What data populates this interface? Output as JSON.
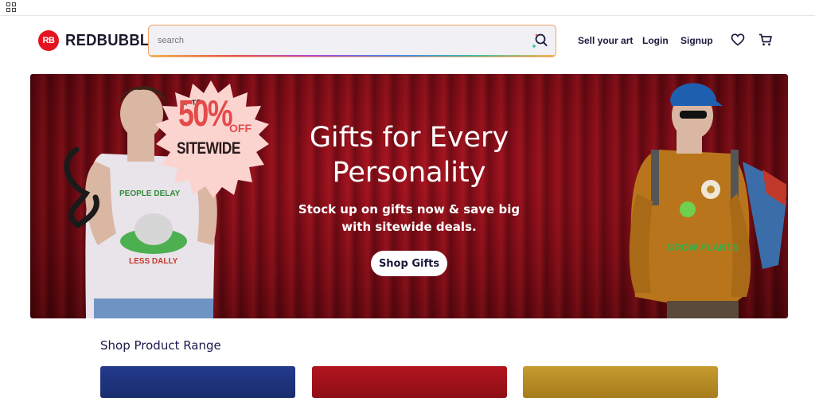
{
  "browser": {
    "apps_icon": "apps-grid-icon"
  },
  "header": {
    "logo_mark": "RB",
    "logo_text": "REDBUBBLE",
    "search_placeholder": "search",
    "nav": {
      "sell": "Sell your art",
      "login": "Login",
      "signup": "Signup"
    },
    "icons": [
      "search-icon",
      "heart-icon",
      "cart-icon"
    ]
  },
  "hero": {
    "badge": {
      "up_to": "UP TO",
      "percent": "50%",
      "off": "OFF",
      "sitewide": "SITEWIDE"
    },
    "title": "Gifts for Every Personality",
    "subtitle": "Stock up on gifts now & save big with sitewide deals.",
    "button": "Shop Gifts",
    "left_shirt_text_top": "PEOPLE DELAY",
    "left_shirt_text_bottom": "LESS DALLY",
    "right_sweater_text": "GROW PLANTS"
  },
  "section": {
    "title": "Shop Product Range"
  },
  "colors": {
    "brand": "#e41321",
    "hero_bg": "#8a0d18",
    "text_dark": "#1a1a3d",
    "search_border": "#f0a26a",
    "badge_bg": "#fbd4d0",
    "badge_text": "#e54a4a"
  }
}
